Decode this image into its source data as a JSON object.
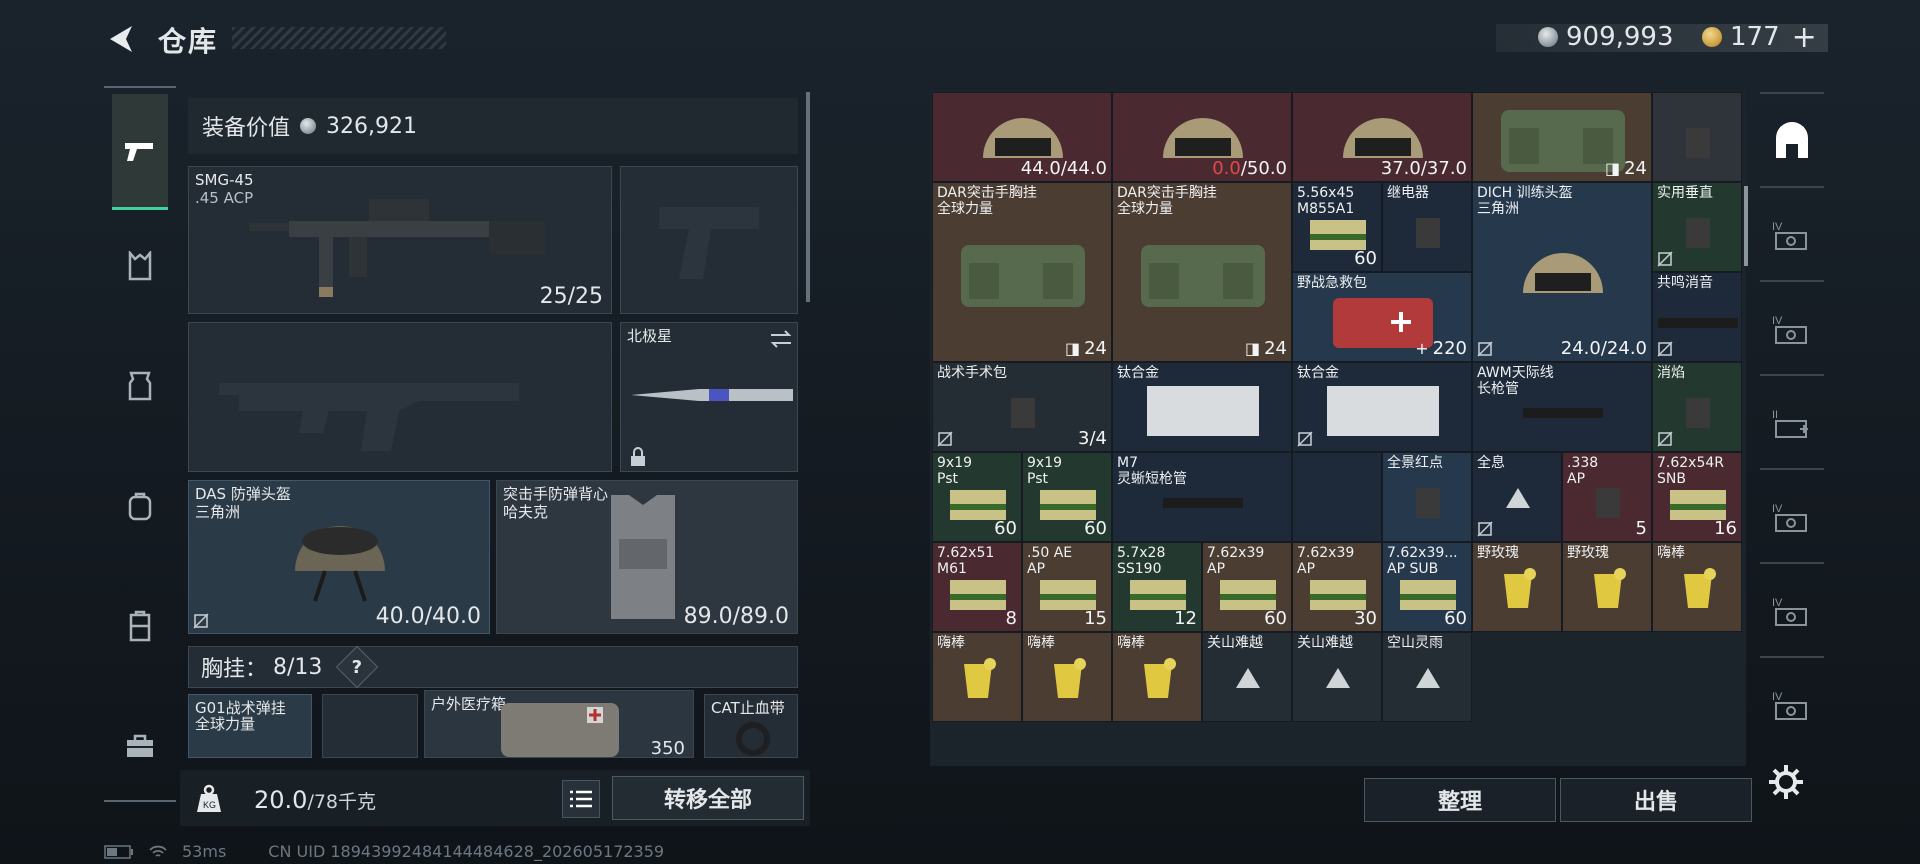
{
  "header": {
    "title": "仓库",
    "currency_silver": "909,993",
    "currency_gold": "177",
    "plus": "+"
  },
  "left": {
    "equip_value_label": "装备价值",
    "equip_value": "326,921",
    "primary": {
      "name": "SMG-45",
      "ammo": ".45 ACP",
      "count": "25/25"
    },
    "melee": {
      "name": "北极星"
    },
    "helmet": {
      "name": "DAS 防弹头盔",
      "brand": "三角洲",
      "durability": "40.0/40.0"
    },
    "armor": {
      "name": "突击手防弹背心",
      "brand": "哈夫克",
      "durability": "89.0/89.0"
    },
    "vest": {
      "label": "胸挂：",
      "count": "8/13",
      "help": "?"
    },
    "vest_items": [
      {
        "name": "G01战术弹挂",
        "brand": "全球力量"
      },
      {
        "name": "户外医疗箱",
        "value": "350"
      },
      {
        "name": "CAT止血带"
      }
    ],
    "weight": "20.0",
    "weight_max": "/78千克",
    "transfer_all": "转移全部"
  },
  "status": {
    "ping": "53ms",
    "uid": "CN UID 18943992484144484628_202605172359"
  },
  "grid": {
    "cells": [
      {
        "label": "",
        "value": "44.0/44.0"
      },
      {
        "label": "",
        "value_red": "0.0",
        "value": "/50.0"
      },
      {
        "label": "",
        "value": "37.0/37.0"
      },
      {
        "label": "",
        "value": "24"
      },
      {
        "label": "",
        "value": ""
      },
      {
        "label": "DAR突击手胸挂\n全球力量",
        "value": "24"
      },
      {
        "label": "DAR突击手胸挂\n全球力量",
        "value": "24"
      },
      {
        "label": "5.56x45\nM855A1",
        "value": "60"
      },
      {
        "label": "继电器",
        "value": ""
      },
      {
        "label": "DICH 训练头盔\n三角洲",
        "value": "24.0/24.0"
      },
      {
        "label": "实用垂直",
        "value": ""
      },
      {
        "label": "野战急救包",
        "value": "220"
      },
      {
        "label": "共鸣消音",
        "value": ""
      },
      {
        "label": "战术手术包",
        "value": "3/4"
      },
      {
        "label": "钛合金",
        "value": ""
      },
      {
        "label": "钛合金",
        "value": ""
      },
      {
        "label": "AWM天际线\n长枪管",
        "value": ""
      },
      {
        "label": "消焰",
        "value": ""
      },
      {
        "label": "9x19\nPst",
        "value": "60"
      },
      {
        "label": "9x19\nPst",
        "value": "60"
      },
      {
        "label": "M7\n灵蜥短枪管",
        "value": ""
      },
      {
        "label": "",
        "value": ""
      },
      {
        "label": "全景红点",
        "value": ""
      },
      {
        "label": "全息",
        "value": ""
      },
      {
        "label": ".338\nAP",
        "value": "5"
      },
      {
        "label": "7.62x54R\nSNB",
        "value": "16"
      },
      {
        "label": "7.62x51\nM61",
        "value": "8"
      },
      {
        "label": ".50 AE\nAP",
        "value": "15"
      },
      {
        "label": "5.7x28\nSS190",
        "value": "12"
      },
      {
        "label": "7.62x39\nAP",
        "value": "60"
      },
      {
        "label": "7.62x39\nAP",
        "value": "30"
      },
      {
        "label": "7.62x39...\nAP SUB",
        "value": "60"
      },
      {
        "label": "野玫瑰",
        "value": ""
      },
      {
        "label": "野玫瑰",
        "value": ""
      },
      {
        "label": "嗨棒",
        "value": ""
      },
      {
        "label": "嗨棒",
        "value": ""
      },
      {
        "label": "嗨棒",
        "value": ""
      },
      {
        "label": "嗨棒",
        "value": ""
      },
      {
        "label": "关山难越",
        "value": ""
      },
      {
        "label": "关山难越",
        "value": ""
      },
      {
        "label": "空山灵雨",
        "value": ""
      }
    ]
  },
  "buttons": {
    "sort": "整理",
    "sell": "出售"
  },
  "colors": {
    "accent": "#3fd0a0",
    "red_cell": "#4a2a30",
    "blue_cell": "#26384c",
    "green_cell": "#23392f",
    "damage_red": "#e04a48"
  }
}
